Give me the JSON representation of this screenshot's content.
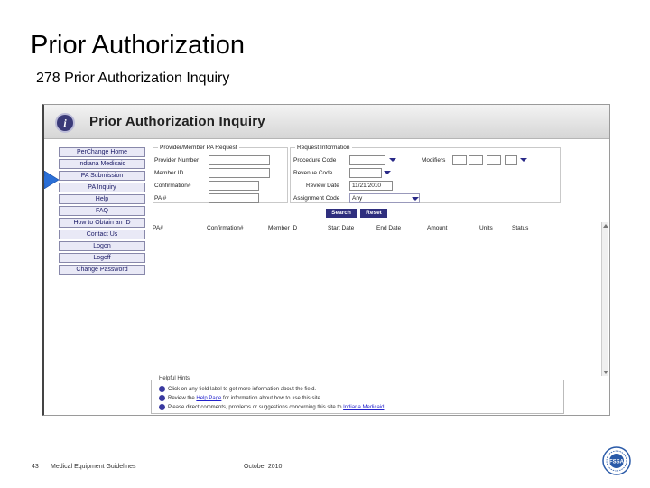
{
  "slide": {
    "title": "Prior Authorization",
    "subtitle": "278 Prior Authorization Inquiry"
  },
  "app": {
    "title": "Prior Authorization Inquiry",
    "logo_letter": "i",
    "logo_icon": "info-circle-icon",
    "nav_items": [
      "PerChange Home",
      "Indiana Medicaid",
      "PA Submission",
      "PA Inquiry",
      "Help",
      "FAQ",
      "How to Obtain an ID",
      "Contact Us",
      "Logon",
      "Logoff",
      "Change Password"
    ],
    "provider_section": {
      "heading": "Provider/Member PA Request",
      "provider_number_label": "Provider Number",
      "member_id_label": "Member ID",
      "confirmation_label": "Confirmation#",
      "pa_label": "PA #"
    },
    "request_section": {
      "heading": "Request Information",
      "procedure_code_label": "Procedure Code",
      "revenue_code_label": "Revenue Code",
      "review_date_label": "Review Date",
      "review_date_value": "11/21/2010",
      "assignment_code_label": "Assignment Code",
      "assignment_code_value": "Any",
      "modifiers_label": "Modifiers"
    },
    "buttons": {
      "search": "Search",
      "reset": "Reset"
    },
    "table_headers": [
      "PA#",
      "Confirmation#",
      "Member ID",
      "Start Date",
      "End Date",
      "Amount",
      "Units",
      "Status"
    ],
    "hints": {
      "title": "Helpful Hints",
      "items": [
        {
          "text": "Click on any field label to get more information about the field.",
          "link": ""
        },
        {
          "text_before": "Review the ",
          "link": "Help Page",
          "text_after": " for information about how to use this site."
        },
        {
          "text_before": "Please direct comments, problems or suggestions concerning this site to ",
          "link": "Indiana Medicaid",
          "text_after": "."
        }
      ]
    }
  },
  "footer": {
    "page_number": "43",
    "section": "Medical Equipment Guidelines",
    "date": "October 2010",
    "seal_text": "FSSA"
  },
  "colors": {
    "nav_text": "#1a1a66",
    "button_bg": "#2f2f7e",
    "arrow": "#2b6fd6",
    "link": "#2222cc"
  }
}
